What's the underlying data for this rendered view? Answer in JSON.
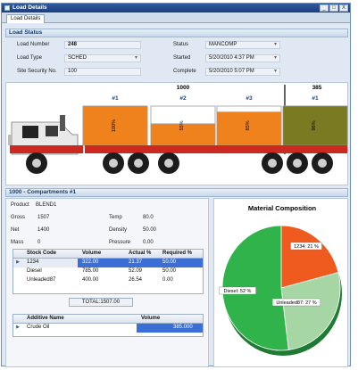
{
  "window": {
    "title": "Load Details",
    "controls": [
      "_",
      "□",
      "X"
    ]
  },
  "tabs": [
    {
      "label": "Load Details"
    }
  ],
  "load_status": {
    "header": "Load Status",
    "load_number_label": "Load Number",
    "load_number": "248",
    "load_type_label": "Load Type",
    "load_type": "SCHED",
    "site_security_label": "Site Security No.",
    "site_security": "100",
    "status_label": "Status",
    "status": "MANCOMP",
    "started_label": "Started",
    "started": "5/20/2010 4:37 PM",
    "complete_label": "Complete",
    "complete": "5/20/2010 5:07 PM"
  },
  "truck": {
    "capacity_left": "1000",
    "capacity_right": "385",
    "compartments": [
      {
        "label": "#1",
        "fill": 1.0,
        "pct": "100%",
        "color": "#f0821e"
      },
      {
        "label": "#2",
        "fill": 0.55,
        "pct": "55%",
        "color": "#f0821e"
      },
      {
        "label": "#3",
        "fill": 0.85,
        "pct": "85%",
        "color": "#f0821e"
      },
      {
        "label": "#1",
        "fill": 1.0,
        "pct": "96%",
        "color": "#7a7a22"
      }
    ]
  },
  "compartment": {
    "header": "1000 - Compartments #1",
    "product_label": "Product",
    "product": "BLEND1",
    "gross_label": "Gross",
    "gross": "1507",
    "net_label": "Net",
    "net": "1400",
    "mass_label": "Mass",
    "mass": "0",
    "temp_label": "Temp",
    "temp": "80.0",
    "density_label": "Density",
    "density": "50.00",
    "pressure_label": "Pressure",
    "pressure": "0.00"
  },
  "stock_table": {
    "headers": [
      "Stock Code",
      "Volume",
      "Actual %",
      "Required %"
    ],
    "rows": [
      [
        "1234",
        "322.00",
        "21.37",
        "50.00"
      ],
      [
        "Diesel",
        "785.00",
        "52.09",
        "50.00"
      ],
      [
        "Unleaded87",
        "400.00",
        "26.54",
        "0.00"
      ]
    ],
    "total": "TOTAL:1507.00"
  },
  "additive_table": {
    "headers": [
      "Additive Name",
      "Volume"
    ],
    "rows": [
      [
        "Crude Oil",
        "385.000"
      ]
    ]
  },
  "chart_data": {
    "type": "pie",
    "title": "Material Composition",
    "slices": [
      {
        "label": "1234: 21 %",
        "value": 21,
        "color": "#ef5a1f"
      },
      {
        "label": "Unleaded87: 27 %",
        "value": 27,
        "color": "#a5d6a3"
      },
      {
        "label": "Diesel: 52 %",
        "value": 52,
        "color": "#2fb34a"
      }
    ]
  },
  "colors": {
    "accent": "#2c5aa0",
    "selection": "#3b6fd6"
  }
}
